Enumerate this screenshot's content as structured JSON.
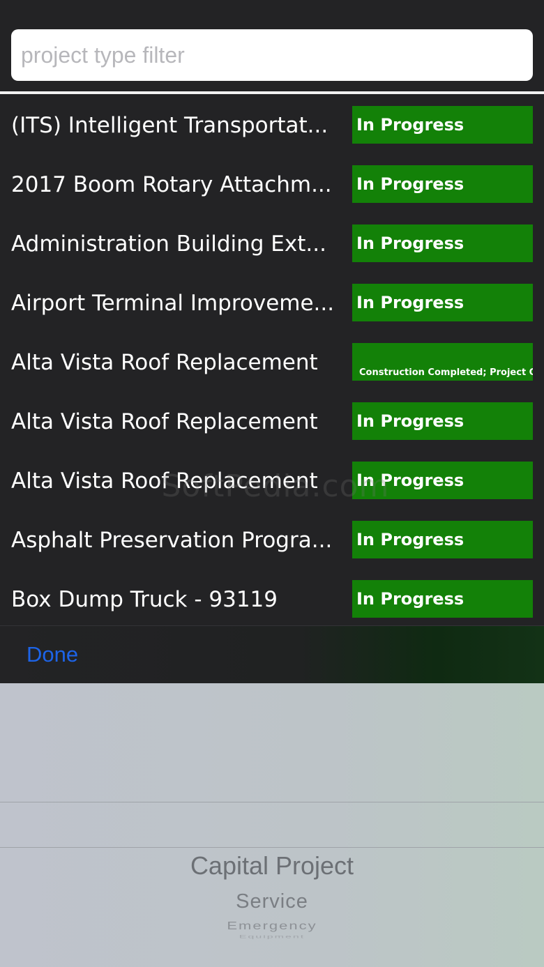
{
  "search": {
    "placeholder": "project type filter",
    "value": ""
  },
  "projects": [
    {
      "title": "(ITS) Intelligent Transportat...",
      "status": "In Progress"
    },
    {
      "title": "2017 Boom Rotary Attachm...",
      "status": "In Progress"
    },
    {
      "title": "Administration Building Ext...",
      "status": "In Progress"
    },
    {
      "title": "Airport Terminal Improveme...",
      "status": "In Progress"
    },
    {
      "title": "Alta Vista Roof Replacement",
      "status": "Construction Completed; Project Cl"
    },
    {
      "title": "Alta Vista Roof Replacement",
      "status": "In Progress"
    },
    {
      "title": "Alta Vista Roof Replacement",
      "status": "In Progress"
    },
    {
      "title": "Asphalt Preservation Progra...",
      "status": "In Progress"
    },
    {
      "title": "Box Dump Truck - 93119",
      "status": "In Progress"
    }
  ],
  "watermark": "SoftPedia.com",
  "toolbar": {
    "done_label": "Done"
  },
  "picker": {
    "selected": "Capital Project",
    "options": [
      "Capital Project",
      "Service",
      "Emergency",
      "Equipment"
    ]
  },
  "colors": {
    "status_green": "#138108",
    "done_blue": "#1d64e8",
    "list_background": "#232325"
  }
}
